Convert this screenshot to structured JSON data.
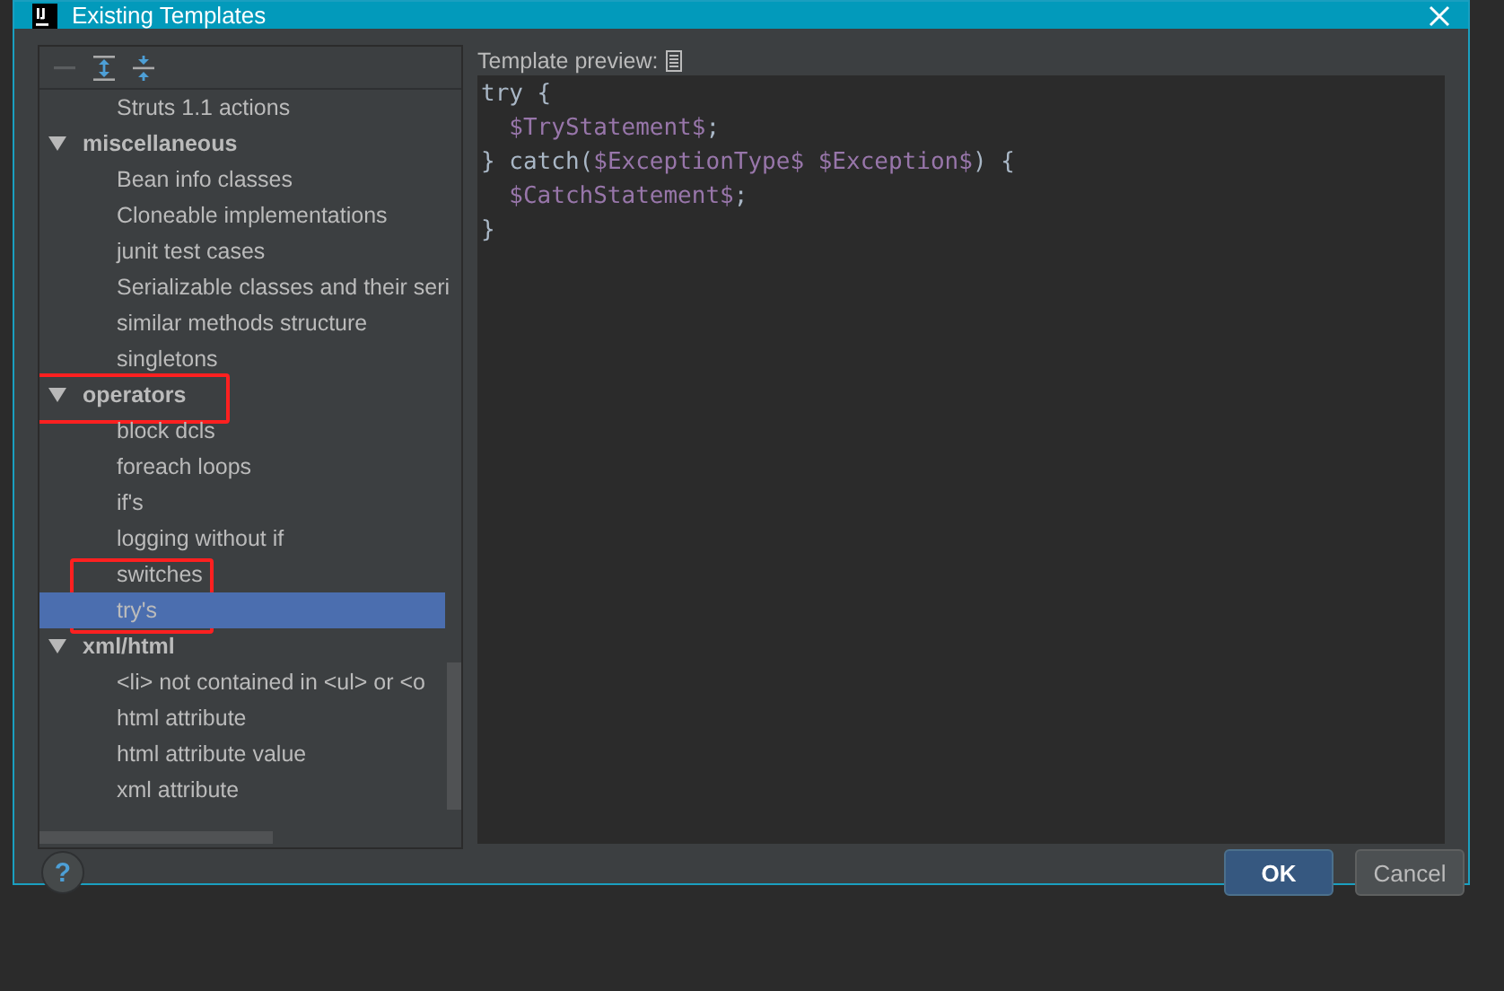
{
  "window": {
    "title": "Existing Templates"
  },
  "tree": [
    {
      "label": "Struts 1.1 actions",
      "selected": false
    },
    {
      "label": "miscellaneous",
      "expanded": true,
      "children": [
        {
          "label": "Bean info classes",
          "selected": false
        },
        {
          "label": "Cloneable implementations",
          "selected": false
        },
        {
          "label": "junit test cases",
          "selected": false
        },
        {
          "label": "Serializable classes and their seri",
          "selected": false
        },
        {
          "label": "similar methods structure",
          "selected": false
        },
        {
          "label": "singletons",
          "selected": false
        }
      ]
    },
    {
      "label": "operators",
      "expanded": true,
      "annotated": true,
      "children": [
        {
          "label": "block dcls",
          "selected": false
        },
        {
          "label": "foreach loops",
          "selected": false
        },
        {
          "label": "if's",
          "selected": false
        },
        {
          "label": "logging without if",
          "selected": false
        },
        {
          "label": "switches",
          "selected": false,
          "annotated": true
        },
        {
          "label": "try's",
          "selected": true
        }
      ]
    },
    {
      "label": "xml/html",
      "expanded": true,
      "children": [
        {
          "label": "<li> not contained in <ul> or <o",
          "selected": false
        },
        {
          "label": "html attribute",
          "selected": false
        },
        {
          "label": "html attribute value",
          "selected": false
        },
        {
          "label": "xml attribute",
          "selected": false
        }
      ]
    }
  ],
  "preview": {
    "label": "Template preview:",
    "lines": [
      {
        "indent": false,
        "parts": [
          {
            "text": "try {",
            "kind": "plain"
          }
        ]
      },
      {
        "indent": true,
        "parts": [
          {
            "text": "$TryStatement$",
            "kind": "var"
          },
          {
            "text": ";",
            "kind": "plain"
          }
        ]
      },
      {
        "indent": false,
        "parts": [
          {
            "text": "} catch(",
            "kind": "plain"
          },
          {
            "text": "$ExceptionType$",
            "kind": "var"
          },
          {
            "text": "$Exception$",
            "kind": "var",
            "space": true
          },
          {
            "text": ") {",
            "kind": "plain"
          }
        ]
      },
      {
        "indent": true,
        "parts": [
          {
            "text": "$CatchStatement$",
            "kind": "var"
          },
          {
            "text": ";",
            "kind": "plain"
          }
        ]
      },
      {
        "indent": false,
        "parts": [
          {
            "text": "}",
            "kind": "plain"
          }
        ]
      }
    ]
  },
  "help": "?",
  "buttons": [
    {
      "label": "OK",
      "kind": "default"
    },
    {
      "label": "Cancel",
      "kind": "normal"
    }
  ]
}
